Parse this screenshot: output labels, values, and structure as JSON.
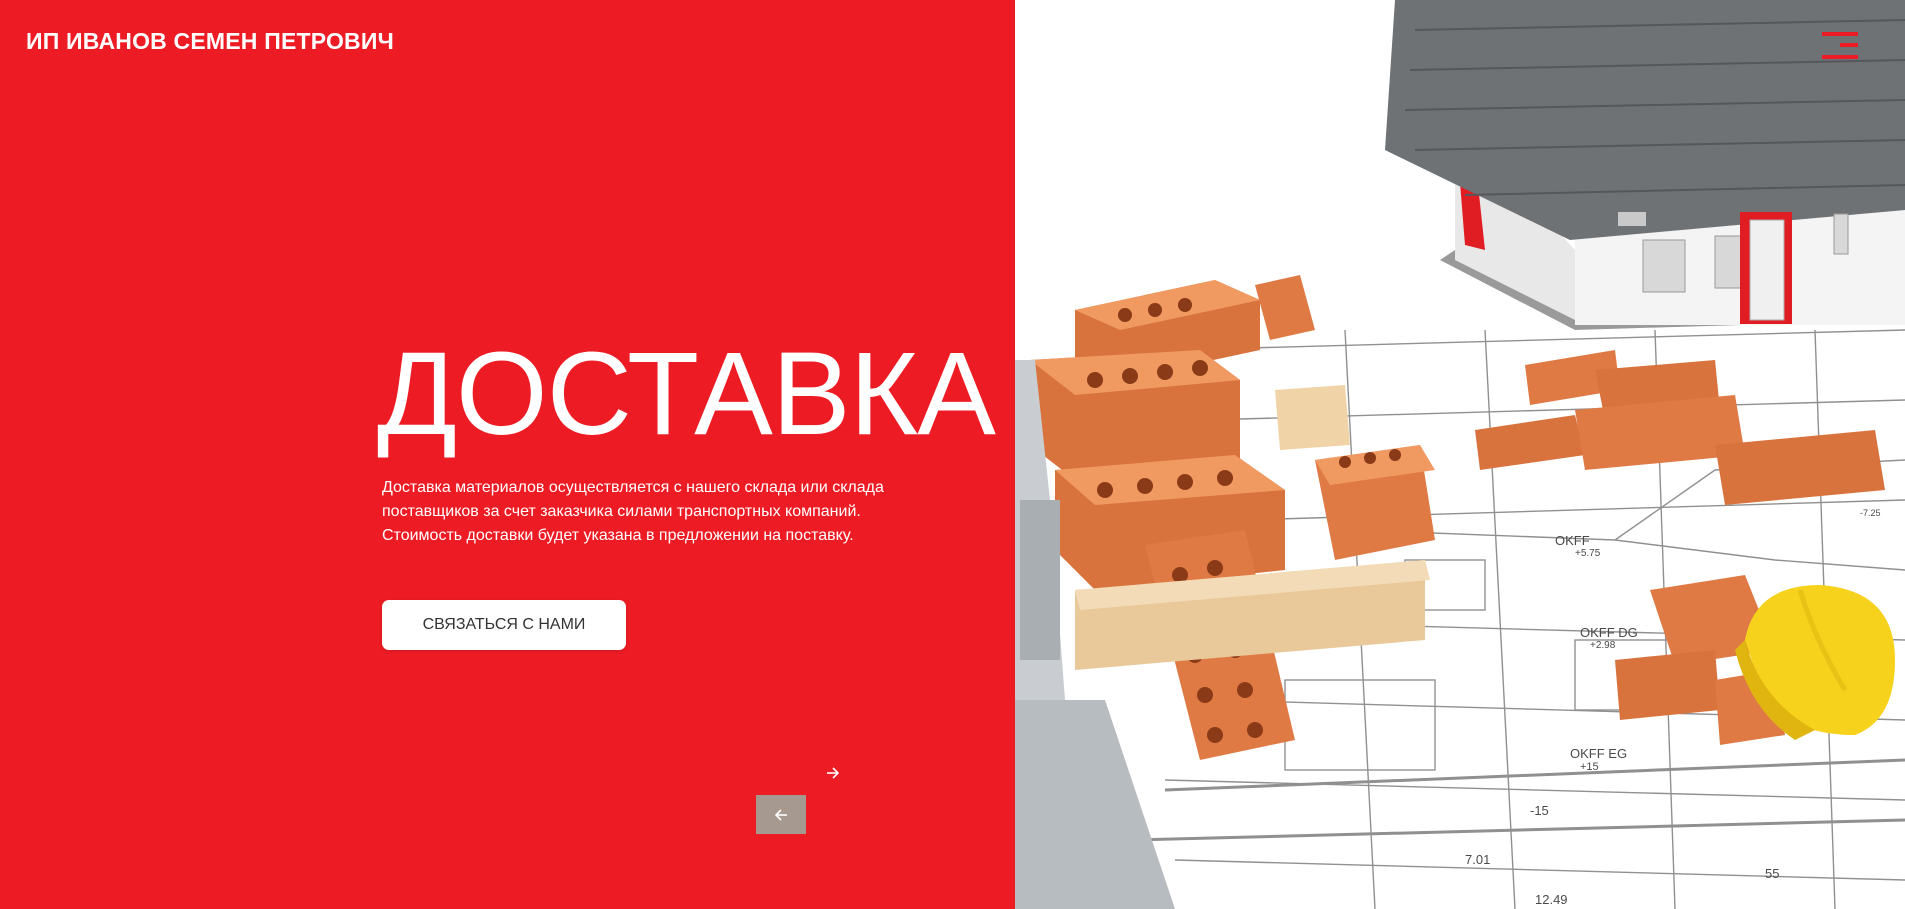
{
  "header": {
    "brand": "ИП ИВАНОВ СЕМЕН ПЕТРОВИЧ",
    "menu_icon": "hamburger-menu-icon"
  },
  "hero": {
    "title": "ДОСТАВКА",
    "description": "Доставка материалов осуществляется с нашего склада или склада поставщиков за счет заказчика силами транспортных компаний. Стоимость доставки будет указана в предложении на поставку.",
    "cta_label": "СВЯЗАТЬСЯ С НАМИ"
  },
  "slider": {
    "next_icon": "arrow-right-icon",
    "prev_icon": "arrow-left-icon"
  },
  "illustration": {
    "labels": {
      "okff1": "OKFF",
      "okff1_val": "+5.75",
      "okff_dg": "OKFF DG",
      "okff_dg_val": "+2.98",
      "okff_eg": "OKFF EG",
      "okff_eg_val": "+15",
      "minus15": "-15",
      "dim1": "7.01",
      "dim2": "12.49",
      "dim3": "55",
      "dim4": "-7.25"
    }
  },
  "colors": {
    "brand_red": "#ed1c24",
    "button_bg": "#ffffff",
    "prev_button_bg": "#a69a90",
    "brick": "#e07a45",
    "helmet": "#f7d21c",
    "roof": "#6f7275"
  }
}
